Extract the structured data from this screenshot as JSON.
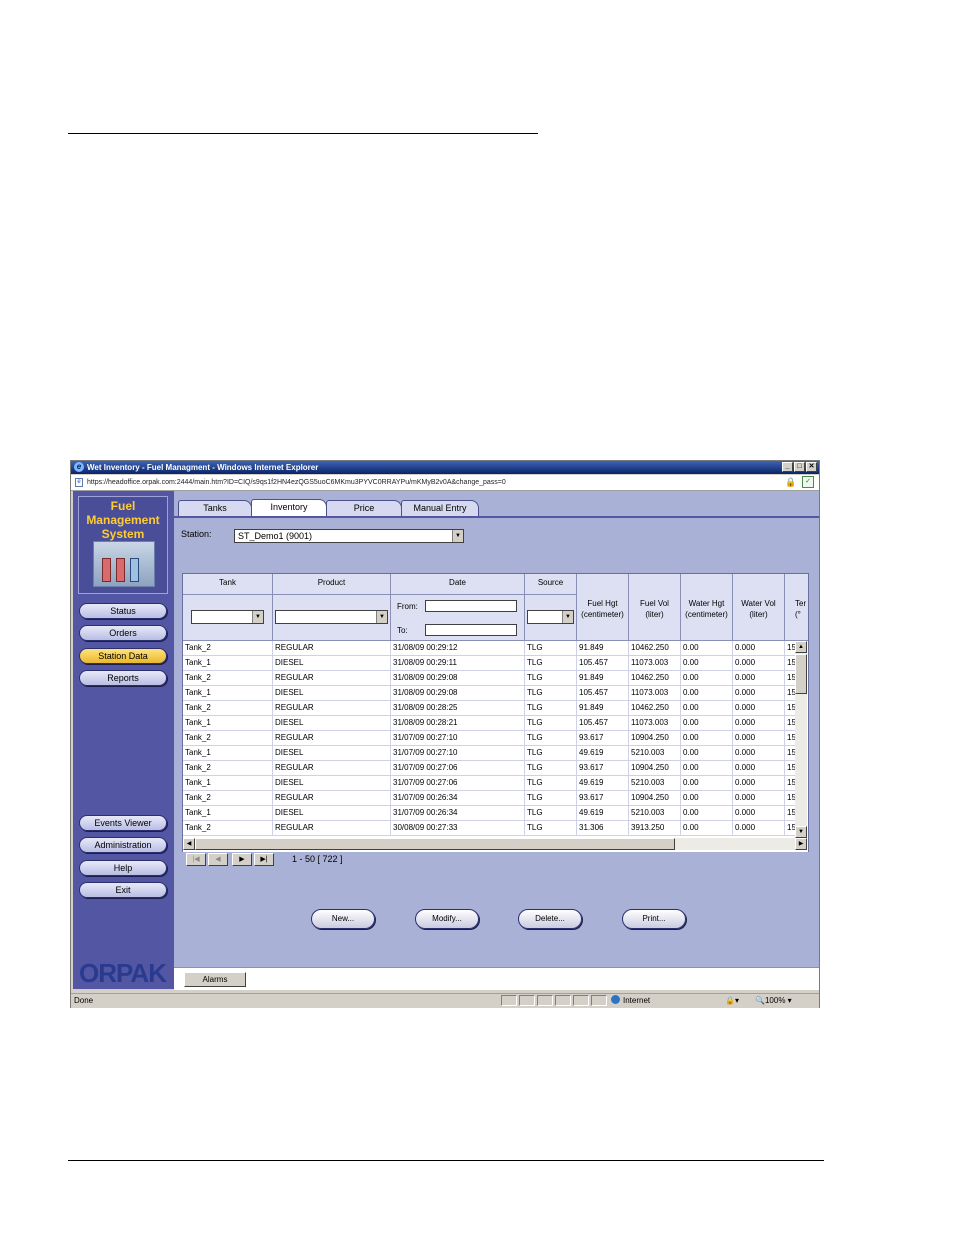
{
  "window": {
    "title": "Wet Inventory - Fuel Managment - Windows Internet Explorer",
    "url": "https://headoffice.orpak.com:2444/main.htm?ID=CIQ/s9qs1f2HN4ezQGS5uoC6MKmu3PYVC0RRAYPu/mKMyB2v0A&change_pass=0"
  },
  "sidebar": {
    "logo_text": [
      "Fuel",
      "Management",
      "System"
    ],
    "items": [
      {
        "label": "Status",
        "active": false
      },
      {
        "label": "Orders",
        "active": false
      },
      {
        "label": "Station Data",
        "active": true
      },
      {
        "label": "Reports",
        "active": false
      }
    ],
    "bottom_items": [
      {
        "label": "Events Viewer"
      },
      {
        "label": "Administration"
      },
      {
        "label": "Help"
      },
      {
        "label": "Exit"
      }
    ],
    "brand": "ORPAK"
  },
  "tabs": [
    {
      "label": "Tanks",
      "active": false
    },
    {
      "label": "Inventory",
      "active": true
    },
    {
      "label": "Price",
      "active": false
    },
    {
      "label": "Manual Entry",
      "active": false
    }
  ],
  "station": {
    "label": "Station:",
    "value": "ST_Demo1 (9001)"
  },
  "grid": {
    "columns": [
      {
        "label": "Tank"
      },
      {
        "label": "Product"
      },
      {
        "label": "Date",
        "from_label": "From:",
        "to_label": "To:"
      },
      {
        "label": "Source"
      },
      {
        "label": "Fuel Hgt (centimeter)",
        "lines": [
          "Fuel Hgt",
          "(centimeter)"
        ]
      },
      {
        "label": "Fuel Vol (liter)",
        "lines": [
          "Fuel Vol",
          "(liter)"
        ]
      },
      {
        "label": "Water Hgt (centimeter)",
        "lines": [
          "Water Hgt",
          "(centimeter)"
        ]
      },
      {
        "label": "Water Vol (liter)",
        "lines": [
          "Water Vol",
          "(liter)"
        ]
      },
      {
        "label": "Ter (°",
        "lines": [
          "Ter",
          "(°"
        ]
      }
    ],
    "rows": [
      [
        "Tank_2",
        "REGULAR",
        "31/08/09 00:29:12",
        "TLG",
        "91.849",
        "10462.250",
        "0.00",
        "0.000",
        "15"
      ],
      [
        "Tank_1",
        "DIESEL",
        "31/08/09 00:29:11",
        "TLG",
        "105.457",
        "11073.003",
        "0.00",
        "0.000",
        "15"
      ],
      [
        "Tank_2",
        "REGULAR",
        "31/08/09 00:29:08",
        "TLG",
        "91.849",
        "10462.250",
        "0.00",
        "0.000",
        "15"
      ],
      [
        "Tank_1",
        "DIESEL",
        "31/08/09 00:29:08",
        "TLG",
        "105.457",
        "11073.003",
        "0.00",
        "0.000",
        "15"
      ],
      [
        "Tank_2",
        "REGULAR",
        "31/08/09 00:28:25",
        "TLG",
        "91.849",
        "10462.250",
        "0.00",
        "0.000",
        "15"
      ],
      [
        "Tank_1",
        "DIESEL",
        "31/08/09 00:28:21",
        "TLG",
        "105.457",
        "11073.003",
        "0.00",
        "0.000",
        "15"
      ],
      [
        "Tank_2",
        "REGULAR",
        "31/07/09 00:27:10",
        "TLG",
        "93.617",
        "10904.250",
        "0.00",
        "0.000",
        "15"
      ],
      [
        "Tank_1",
        "DIESEL",
        "31/07/09 00:27:10",
        "TLG",
        "49.619",
        "5210.003",
        "0.00",
        "0.000",
        "15"
      ],
      [
        "Tank_2",
        "REGULAR",
        "31/07/09 00:27:06",
        "TLG",
        "93.617",
        "10904.250",
        "0.00",
        "0.000",
        "15"
      ],
      [
        "Tank_1",
        "DIESEL",
        "31/07/09 00:27:06",
        "TLG",
        "49.619",
        "5210.003",
        "0.00",
        "0.000",
        "15"
      ],
      [
        "Tank_2",
        "REGULAR",
        "31/07/09 00:26:34",
        "TLG",
        "93.617",
        "10904.250",
        "0.00",
        "0.000",
        "15"
      ],
      [
        "Tank_1",
        "DIESEL",
        "31/07/09 00:26:34",
        "TLG",
        "49.619",
        "5210.003",
        "0.00",
        "0.000",
        "15"
      ],
      [
        "Tank_2",
        "REGULAR",
        "30/08/09 00:27:33",
        "TLG",
        "31.306",
        "3913.250",
        "0.00",
        "0.000",
        "15"
      ]
    ]
  },
  "pager": {
    "text": "1 - 50  [ 722 ]"
  },
  "actions": [
    {
      "label": "New..."
    },
    {
      "label": "Modify..."
    },
    {
      "label": "Delete..."
    },
    {
      "label": "Print..."
    }
  ],
  "alarms_label": "Alarms",
  "statusbar": {
    "left": "Done",
    "zone": "Internet",
    "zoom": "100%"
  }
}
